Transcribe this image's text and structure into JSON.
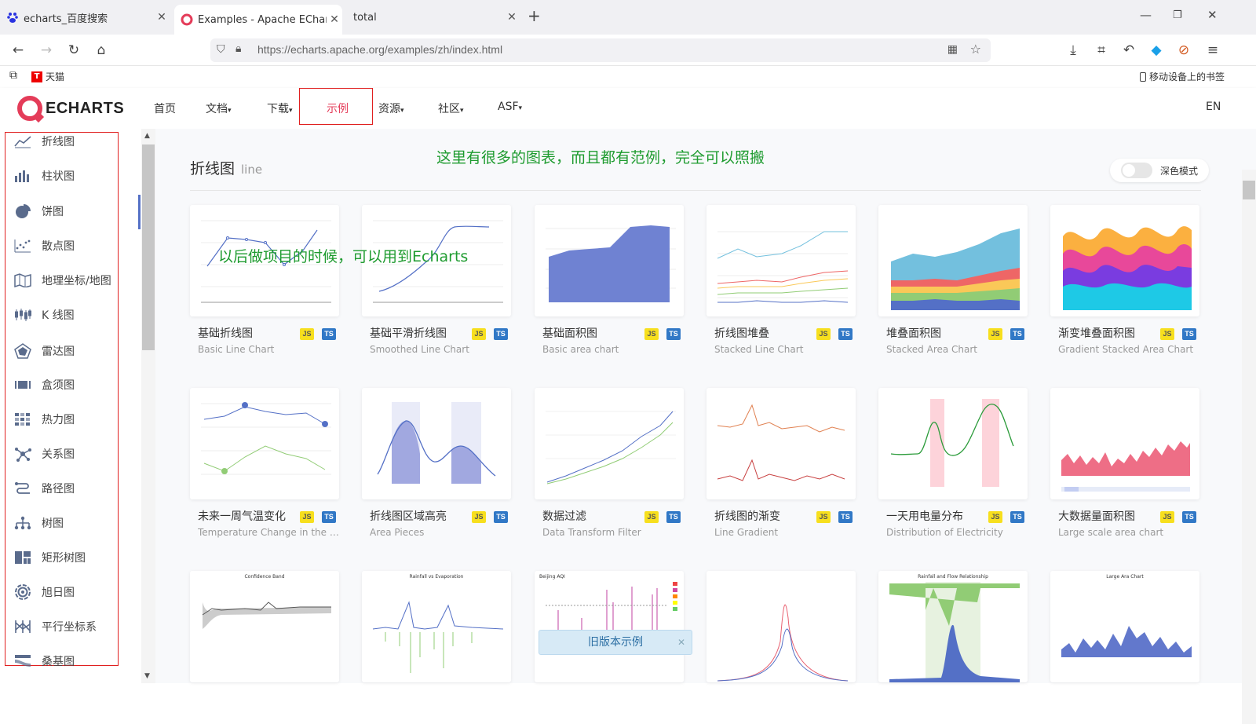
{
  "browser": {
    "tabs": [
      {
        "title": "echarts_百度搜索",
        "active": false
      },
      {
        "title": "Examples - Apache ECharts",
        "active": true
      },
      {
        "title": "total",
        "active": false
      }
    ],
    "url": "https://echarts.apache.org/examples/zh/index.html",
    "bookmarks": [
      {
        "label": "天猫"
      }
    ],
    "mobile_bookmarks": "移动设备上的书签"
  },
  "site": {
    "logo_text": "ECHARTS",
    "nav": [
      {
        "label": "首页"
      },
      {
        "label": "文档"
      },
      {
        "label": "下载"
      },
      {
        "label": "示例"
      },
      {
        "label": "资源"
      },
      {
        "label": "社区"
      },
      {
        "label": "ASF"
      }
    ],
    "lang": "EN",
    "sidebar": [
      {
        "label": "折线图",
        "icon": "line-chart-icon"
      },
      {
        "label": "柱状图",
        "icon": "bar-chart-icon"
      },
      {
        "label": "饼图",
        "icon": "pie-chart-icon"
      },
      {
        "label": "散点图",
        "icon": "scatter-chart-icon"
      },
      {
        "label": "地理坐标/地图",
        "icon": "map-icon"
      },
      {
        "label": "K 线图",
        "icon": "candlestick-icon"
      },
      {
        "label": "雷达图",
        "icon": "radar-icon"
      },
      {
        "label": "盒须图",
        "icon": "boxplot-icon"
      },
      {
        "label": "热力图",
        "icon": "heatmap-icon"
      },
      {
        "label": "关系图",
        "icon": "graph-icon"
      },
      {
        "label": "路径图",
        "icon": "lines-icon"
      },
      {
        "label": "树图",
        "icon": "tree-icon"
      },
      {
        "label": "矩形树图",
        "icon": "treemap-icon"
      },
      {
        "label": "旭日图",
        "icon": "sunburst-icon"
      },
      {
        "label": "平行坐标系",
        "icon": "parallel-icon"
      },
      {
        "label": "桑基图",
        "icon": "sankey-icon"
      }
    ],
    "section_title": "折线图",
    "section_sub": "line",
    "dark_mode_label": "深色模式",
    "annotation_top": "这里有很多的图表，而且都有范例，完全可以照搬",
    "annotation_mid": "以后做项目的时候，可以用到Echarts",
    "badge_js": "JS",
    "badge_ts": "TS",
    "cards": [
      {
        "title": "基础折线图",
        "subtitle": "Basic Line Chart"
      },
      {
        "title": "基础平滑折线图",
        "subtitle": "Smoothed Line Chart"
      },
      {
        "title": "基础面积图",
        "subtitle": "Basic area chart"
      },
      {
        "title": "折线图堆叠",
        "subtitle": "Stacked Line Chart"
      },
      {
        "title": "堆叠面积图",
        "subtitle": "Stacked Area Chart"
      },
      {
        "title": "渐变堆叠面积图",
        "subtitle": "Gradient Stacked Area Chart"
      },
      {
        "title": "未来一周气温变化",
        "subtitle": "Temperature Change in the Co..."
      },
      {
        "title": "折线图区域高亮",
        "subtitle": "Area Pieces"
      },
      {
        "title": "数据过滤",
        "subtitle": "Data Transform Filter"
      },
      {
        "title": "折线图的渐变",
        "subtitle": "Line Gradient"
      },
      {
        "title": "一天用电量分布",
        "subtitle": "Distribution of Electricity"
      },
      {
        "title": "大数据量面积图",
        "subtitle": "Large scale area chart"
      }
    ],
    "third_row_titles": [
      "Confidence Band",
      "Rainfall vs Evaporation",
      "Beijing AQI",
      "",
      "Rainfall and Flow Relationship",
      "Large Ara Chart"
    ],
    "old_version": "旧版本示例"
  }
}
